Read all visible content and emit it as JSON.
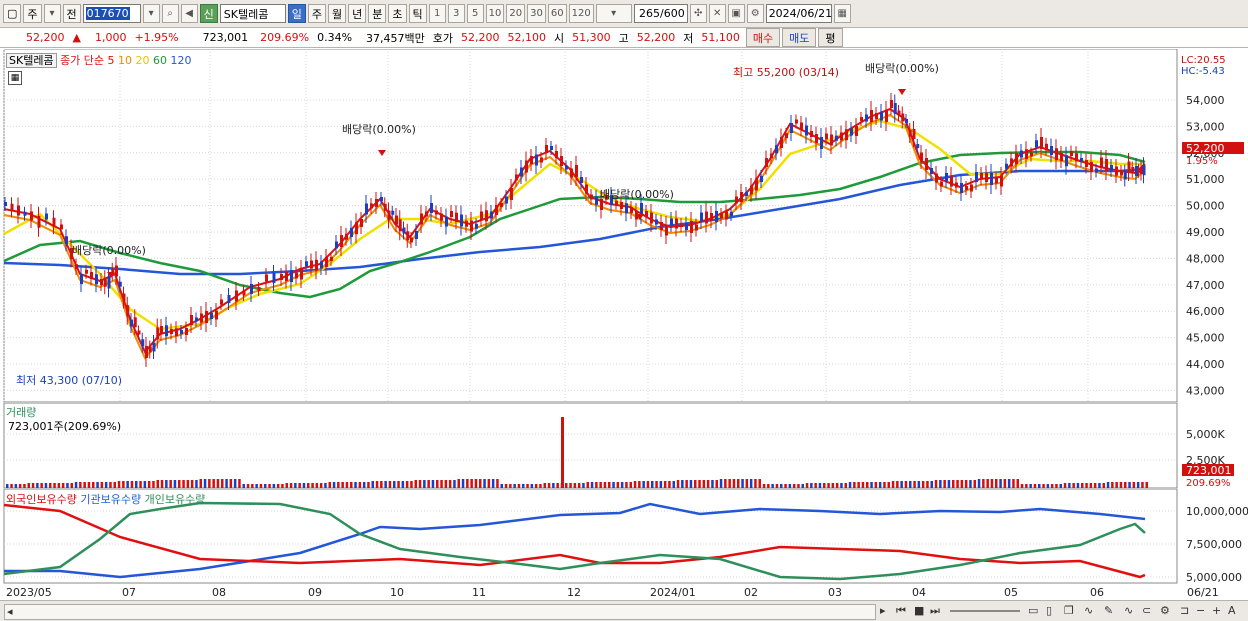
{
  "toolbar": {
    "period_label": "주",
    "prev_label": "전",
    "code": "017670",
    "name": "SK텔레콤",
    "credit_badge": "신",
    "period_tabs": [
      "일",
      "주",
      "월",
      "년",
      "분",
      "초",
      "틱"
    ],
    "interval_buttons": [
      "1",
      "3",
      "5",
      "10",
      "20",
      "30",
      "60",
      "120"
    ],
    "count": "265",
    "count_total": "/600",
    "date": "2024/06/21"
  },
  "quote": {
    "price": "52,200",
    "change": "1,000",
    "change_pct": "+1.95%",
    "volume": "723,001",
    "volume_ratio": "209.69%",
    "turnover": "0.34%",
    "amount": "37,457백만",
    "bid_label": "호가",
    "ask": "52,200",
    "bid": "52,100",
    "open_label": "시",
    "open": "51,300",
    "high_label": "고",
    "high": "52,200",
    "low_label": "저",
    "low": "51,100",
    "buy_label": "매수",
    "sell_label": "매도",
    "extra_label": "평"
  },
  "price_panel": {
    "name_tag": "SK텔레콤",
    "ma_label": "종가 단순",
    "ma_periods": [
      "5",
      "10",
      "20",
      "60",
      "120"
    ],
    "lc": "LC:20.55",
    "hc": "HC:-5.43",
    "current_tag": "52,200",
    "current_pct": "1.95%",
    "y_labels": [
      "54,000",
      "53,000",
      "52,000",
      "51,000",
      "50,000",
      "49,000",
      "48,000",
      "47,000",
      "46,000",
      "45,000",
      "44,000",
      "43,000"
    ],
    "annotations": {
      "high": "최고 55,200 (03/14)",
      "low": "최저 43,300 (07/10)",
      "div1": "배당락(0.00%)",
      "div2": "배당락(0.00%)",
      "div3": "배당락(0.00%)",
      "div4": "배당락(0.00%)"
    }
  },
  "volume_panel": {
    "title": "거래량",
    "value_label": "723,001주(209.69%)",
    "y_labels": [
      "5,000K",
      "2,500K"
    ],
    "current_tag": "723,001",
    "current_pct": "209.69%"
  },
  "holdings_panel": {
    "series": [
      "외국인보유수량",
      "기관보유수량",
      "개인보유수량"
    ],
    "y_labels": [
      "10,000,000",
      "7,500,000",
      "5,000,000"
    ]
  },
  "x_axis": {
    "labels": [
      "2023/05",
      "07",
      "08",
      "09",
      "10",
      "11",
      "12",
      "2024/01",
      "02",
      "03",
      "04",
      "05",
      "06",
      "06/21"
    ]
  },
  "colors": {
    "up": "#d21010",
    "down": "#1a3fc4",
    "ma5": "#e01010",
    "ma10": "#f08c00",
    "ma20": "#f0e000",
    "ma60": "#1f9a3a",
    "ma120": "#2456d8",
    "foreign": "#2456d8",
    "institution": "#e01010",
    "individual": "#2f8f5a"
  }
}
